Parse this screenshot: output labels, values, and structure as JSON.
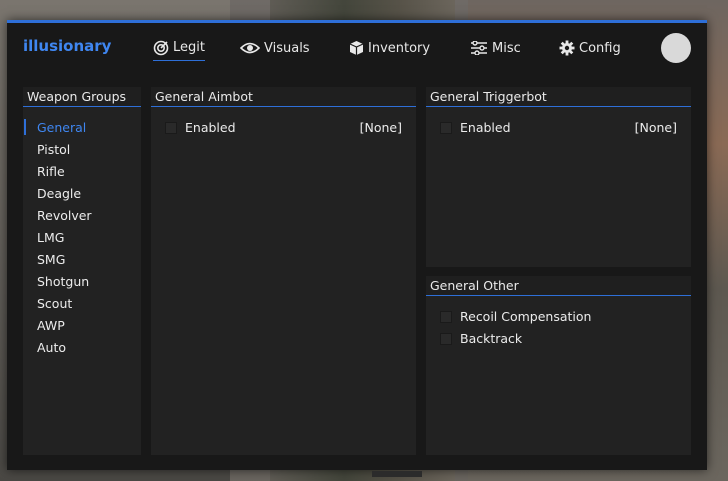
{
  "app": {
    "logo": "illusionary",
    "accent": "#2e6fd8"
  },
  "tabs": [
    {
      "label": "Legit",
      "icon": "target-icon",
      "active": true
    },
    {
      "label": "Visuals",
      "icon": "eye-icon"
    },
    {
      "label": "Inventory",
      "icon": "box-icon"
    },
    {
      "label": "Misc",
      "icon": "sliders-icon"
    },
    {
      "label": "Config",
      "icon": "gear-icon"
    }
  ],
  "weapon_groups": {
    "title": "Weapon Groups",
    "items": [
      "General",
      "Pistol",
      "Rifle",
      "Deagle",
      "Revolver",
      "LMG",
      "SMG",
      "Shotgun",
      "Scout",
      "AWP",
      "Auto"
    ],
    "selected": "General"
  },
  "aimbot": {
    "title": "General Aimbot",
    "enabled_label": "Enabled",
    "enabled_key": "[None]"
  },
  "triggerbot": {
    "title": "General Triggerbot",
    "enabled_label": "Enabled",
    "enabled_key": "[None]"
  },
  "other": {
    "title": "General Other",
    "items": [
      "Recoil Compensation",
      "Backtrack"
    ]
  }
}
